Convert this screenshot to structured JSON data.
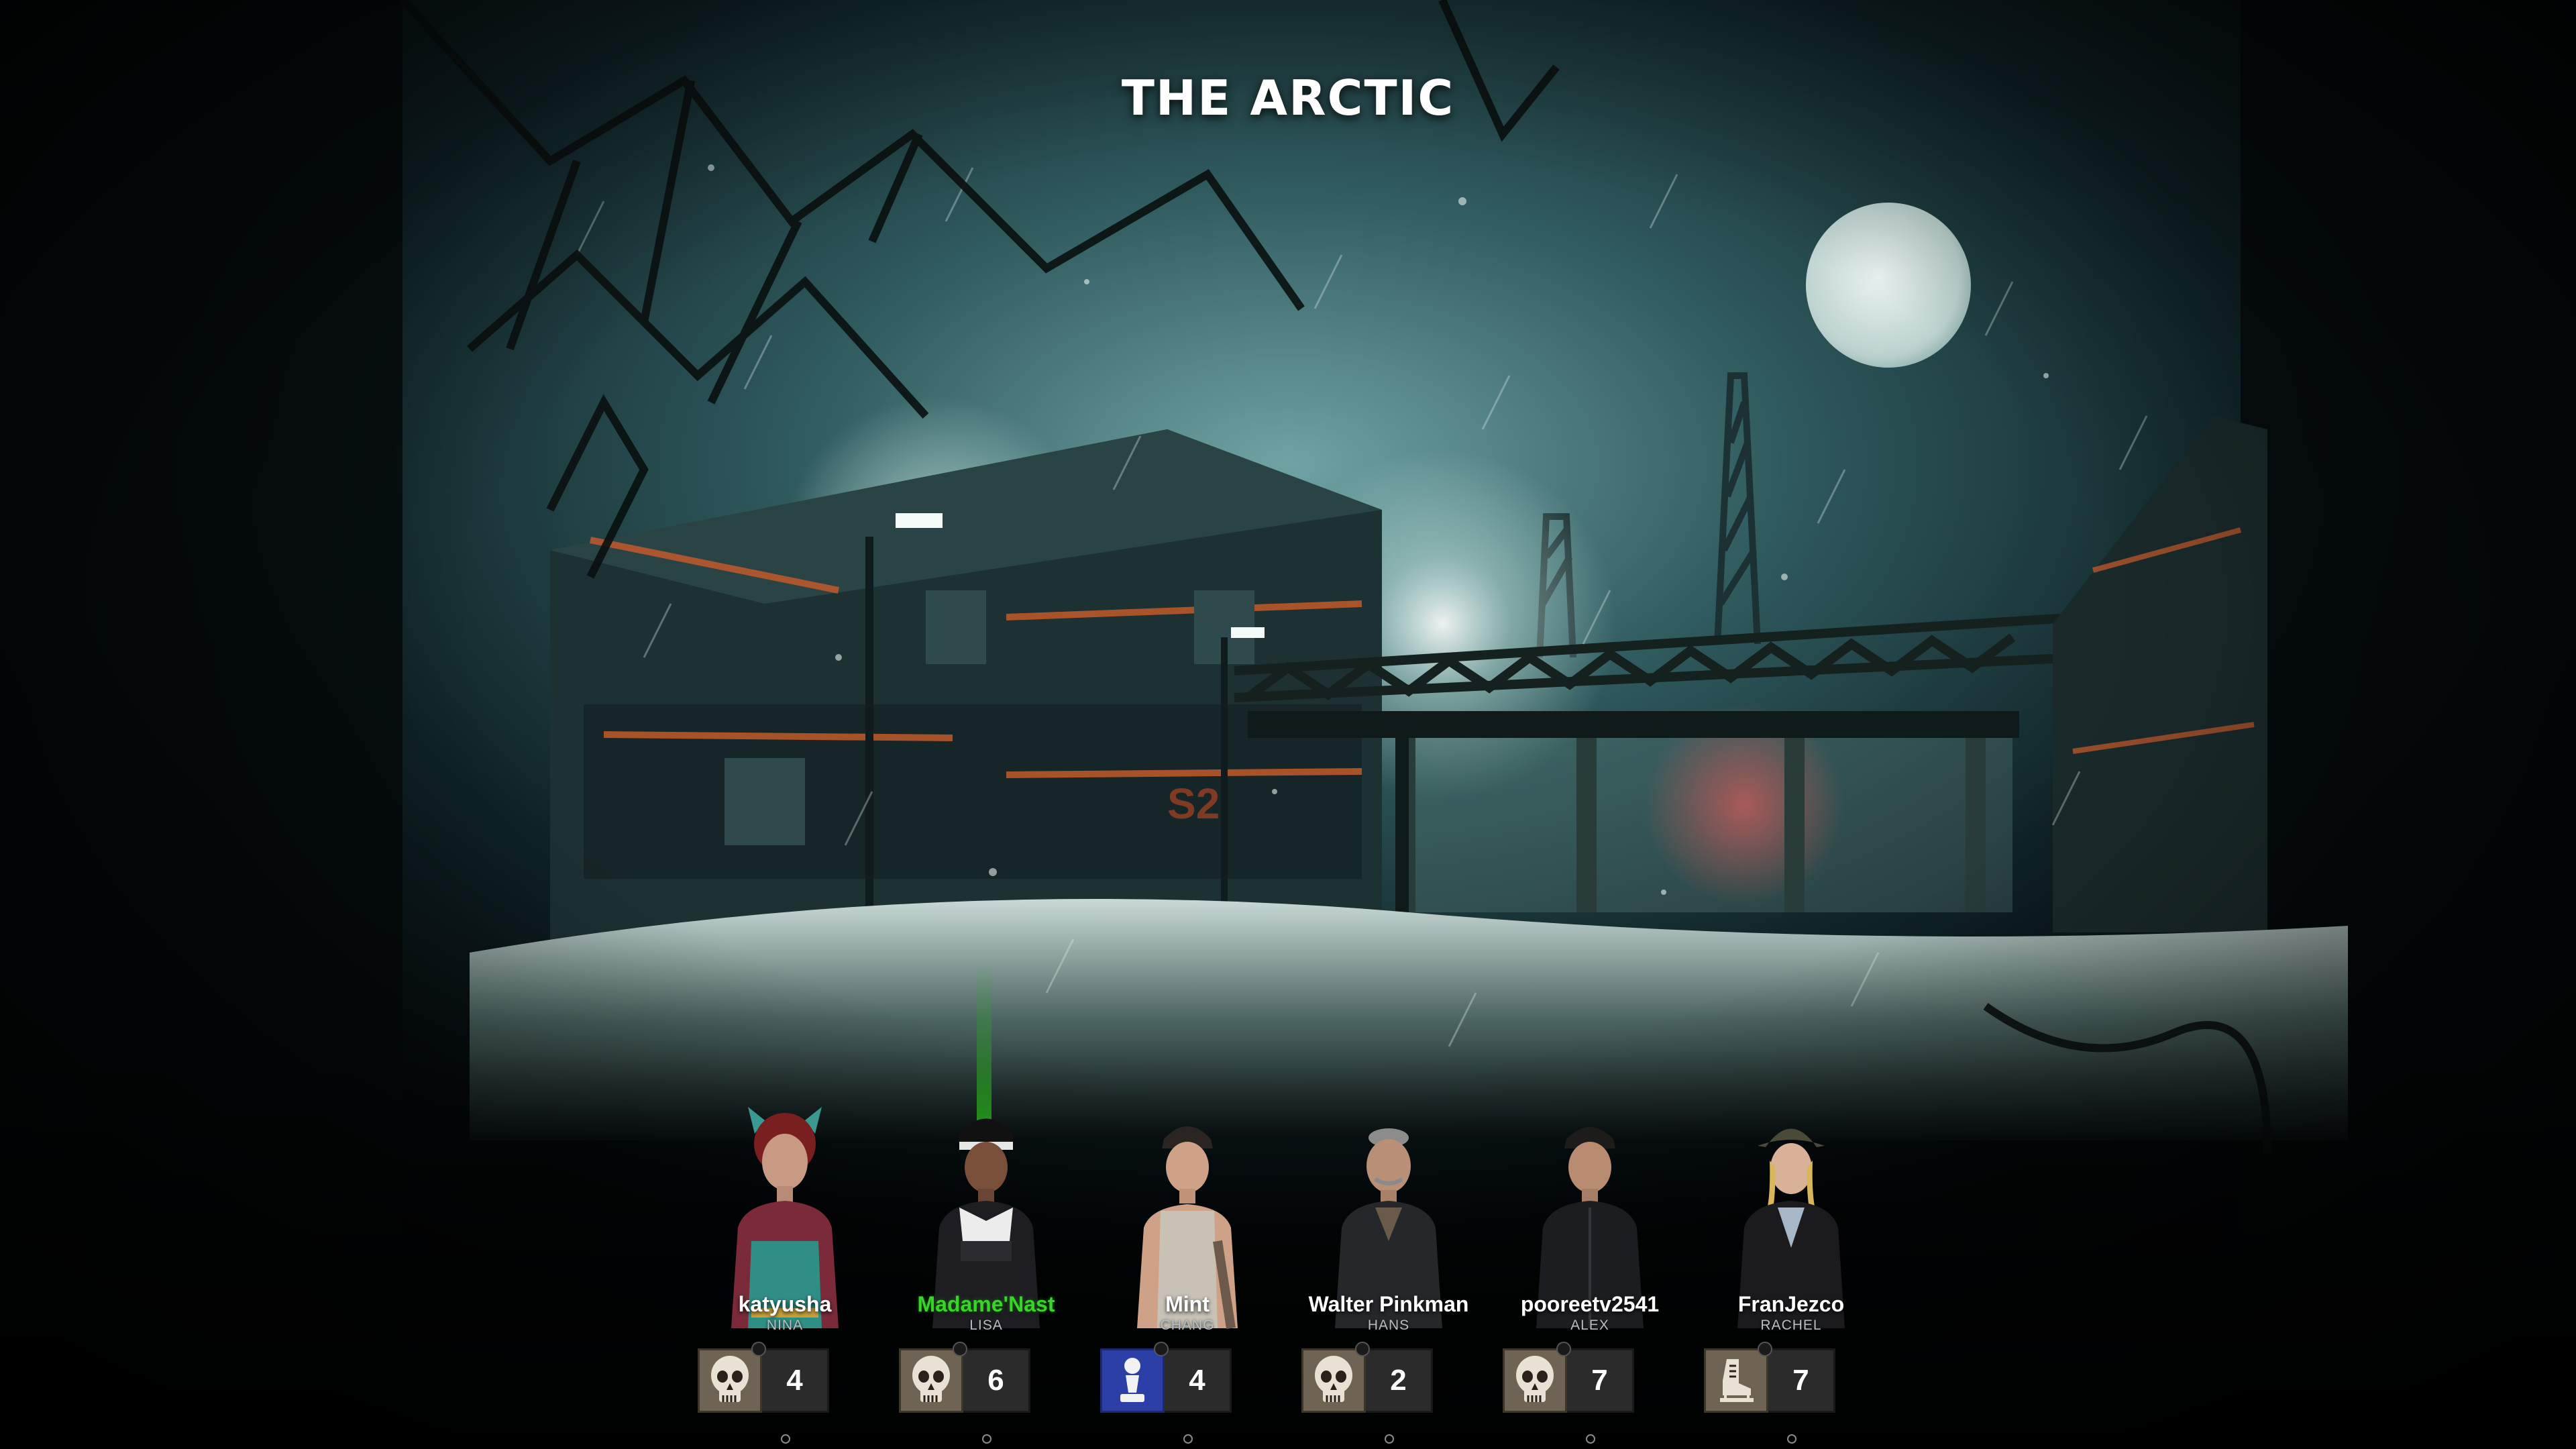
{
  "map": {
    "title": "THE ARCTIC"
  },
  "colors": {
    "host_name": "#3bd22b",
    "role_badge": "#6f6354",
    "pawn_badge": "#2c3fa6",
    "score_bg": "#2c2b2b"
  },
  "players": [
    {
      "name": "katyusha",
      "character": "NINA",
      "role_icon": "skull-icon",
      "score": "4",
      "host": false
    },
    {
      "name": "Madame'Nast",
      "character": "LISA",
      "role_icon": "skull-icon",
      "score": "6",
      "host": true
    },
    {
      "name": "Mint",
      "character": "CHANG",
      "role_icon": "chess-pawn-icon",
      "score": "4",
      "host": false
    },
    {
      "name": "Walter Pinkman",
      "character": "HANS",
      "role_icon": "skull-icon",
      "score": "2",
      "host": false
    },
    {
      "name": "pooreetv2541",
      "character": "ALEX",
      "role_icon": "skull-icon",
      "score": "7",
      "host": false
    },
    {
      "name": "FranJezco",
      "character": "RACHEL",
      "role_icon": "ice-skate-icon",
      "score": "7",
      "host": false
    }
  ]
}
